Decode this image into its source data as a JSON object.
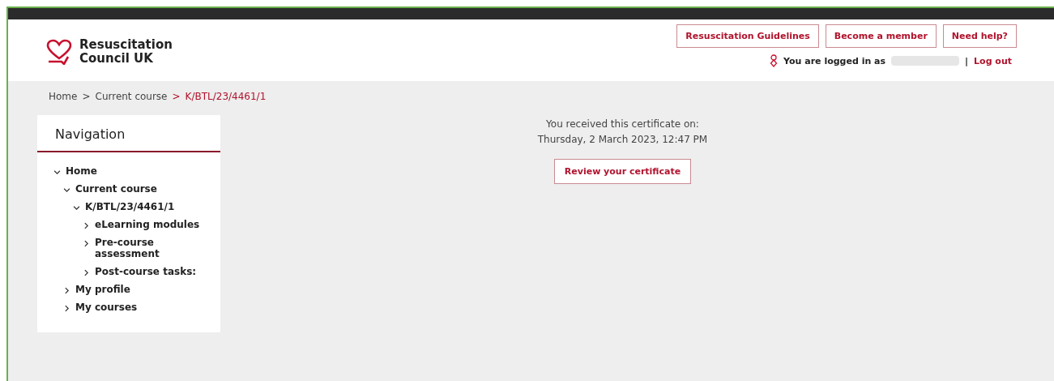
{
  "header": {
    "logo": {
      "line1": "Resuscitation",
      "line2": "Council UK"
    },
    "buttons": [
      "Resuscitation Guidelines",
      "Become a member",
      "Need help?"
    ],
    "user": {
      "label": "You are logged in as",
      "separator": "|",
      "logout": "Log out"
    }
  },
  "breadcrumb": [
    {
      "label": "Home",
      "current": false
    },
    {
      "label": "Current course",
      "current": false
    },
    {
      "label": "K/BTL/23/4461/1",
      "current": true
    }
  ],
  "breadcrumb_separator": ">",
  "navigation": {
    "title": "Navigation",
    "items": [
      {
        "label": "Home",
        "expanded": true,
        "children": [
          {
            "label": "Current course",
            "expanded": true,
            "children": [
              {
                "label": "K/BTL/23/4461/1",
                "expanded": true,
                "children": [
                  {
                    "label": "eLearning modules",
                    "expanded": false
                  },
                  {
                    "label": "Pre-course assessment",
                    "expanded": false
                  },
                  {
                    "label": "Post-course tasks:",
                    "expanded": false
                  }
                ]
              }
            ]
          },
          {
            "label": "My profile",
            "expanded": false
          },
          {
            "label": "My courses",
            "expanded": false
          }
        ]
      }
    ]
  },
  "certificate": {
    "line1": "You received this certificate on:",
    "line2": "Thursday, 2 March 2023, 12:47 PM",
    "button": "Review your certificate"
  }
}
